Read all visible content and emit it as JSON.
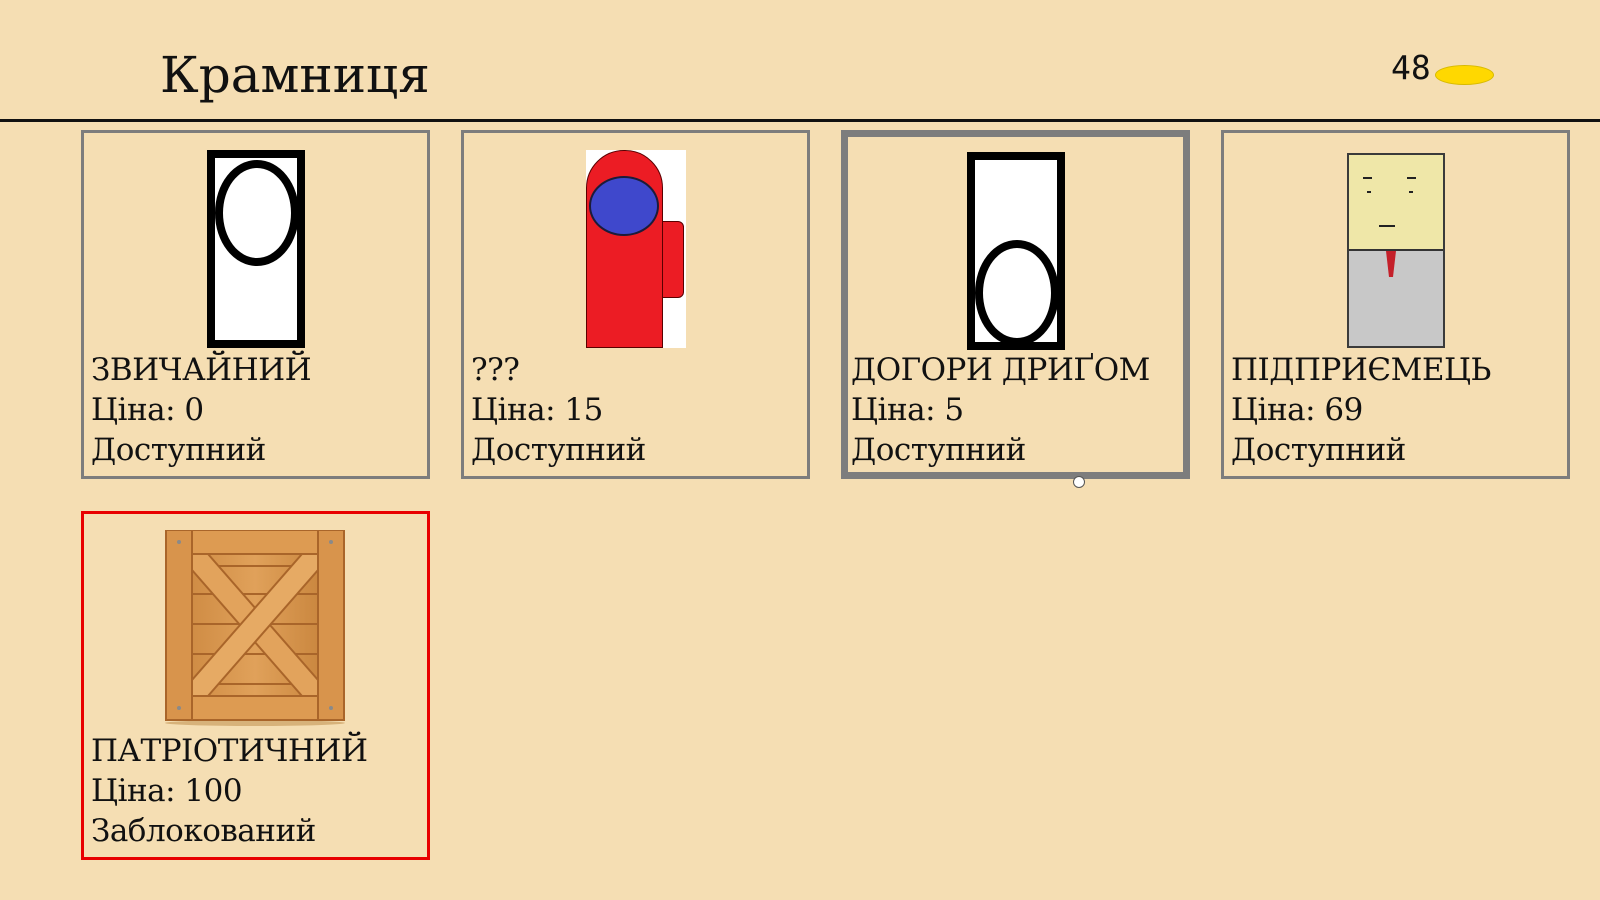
{
  "colors": {
    "background": "#f5deb3",
    "coin": "#ffd800",
    "card_border": "#7d7d7d",
    "locked_border": "#e80000",
    "crew_red": "#ec1c24",
    "crew_visor": "#3f48cc",
    "tie_red": "#c4202a"
  },
  "header": {
    "title": "Крамниця",
    "coins": "48",
    "coin_icon": "gold-coin-icon"
  },
  "skins": [
    {
      "name": "ЗВИЧАЙНИЙ",
      "price": "Ціна: 0",
      "status": "Доступний",
      "icon": "regular-character-icon",
      "state": "normal"
    },
    {
      "name": "???",
      "price": "Ціна: 15",
      "status": "Доступний",
      "icon": "crewmate-character-icon",
      "state": "normal"
    },
    {
      "name": "ДОГОРИ ДРИҐОМ",
      "price": "Ціна: 5",
      "status": "Доступний",
      "icon": "upside-down-character-icon",
      "state": "selected"
    },
    {
      "name": "ПІДПРИЄМЕЦЬ",
      "price": "Ціна: 69",
      "status": "Доступний",
      "icon": "businessman-character-icon",
      "state": "normal"
    },
    {
      "name": "ПАТРІОТИЧНИЙ",
      "price": "Ціна: 100",
      "status": "Заблокований",
      "icon": "wooden-crate-icon",
      "state": "locked"
    }
  ]
}
